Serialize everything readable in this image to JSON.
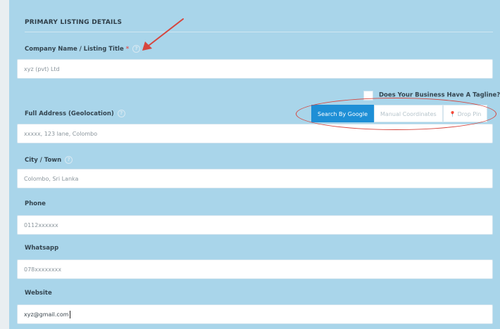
{
  "section": {
    "title": "PRIMARY LISTING DETAILS"
  },
  "fields": {
    "company": {
      "label": "Company Name / Listing Title",
      "required_mark": "*",
      "value": "xyz (pvt) Ltd"
    },
    "tagline": {
      "label": "Does Your Business Have A Tagline?"
    },
    "address": {
      "label": "Full Address (Geolocation)",
      "value": "xxxxx, 123 lane, Colombo"
    },
    "city": {
      "label": "City / Town",
      "value": "Colombo, Sri Lanka"
    },
    "phone": {
      "label": "Phone",
      "value": "0112xxxxxx"
    },
    "whatsapp": {
      "label": "Whatsapp",
      "value": "078xxxxxxxx"
    },
    "website": {
      "label": "Website",
      "value": "xyz@gmail.com"
    }
  },
  "geo_tabs": [
    {
      "label": "Search By Google",
      "active": true
    },
    {
      "label": "Manual Coordinates",
      "active": false
    },
    {
      "label": "Drop Pin",
      "active": false
    }
  ],
  "help_glyph": "?",
  "pin_glyph": "📍",
  "colors": {
    "accent": "#1e8fd6",
    "panel_bg": "#a9d5ea",
    "annotation": "#d6453d",
    "required": "#e05a5a"
  }
}
